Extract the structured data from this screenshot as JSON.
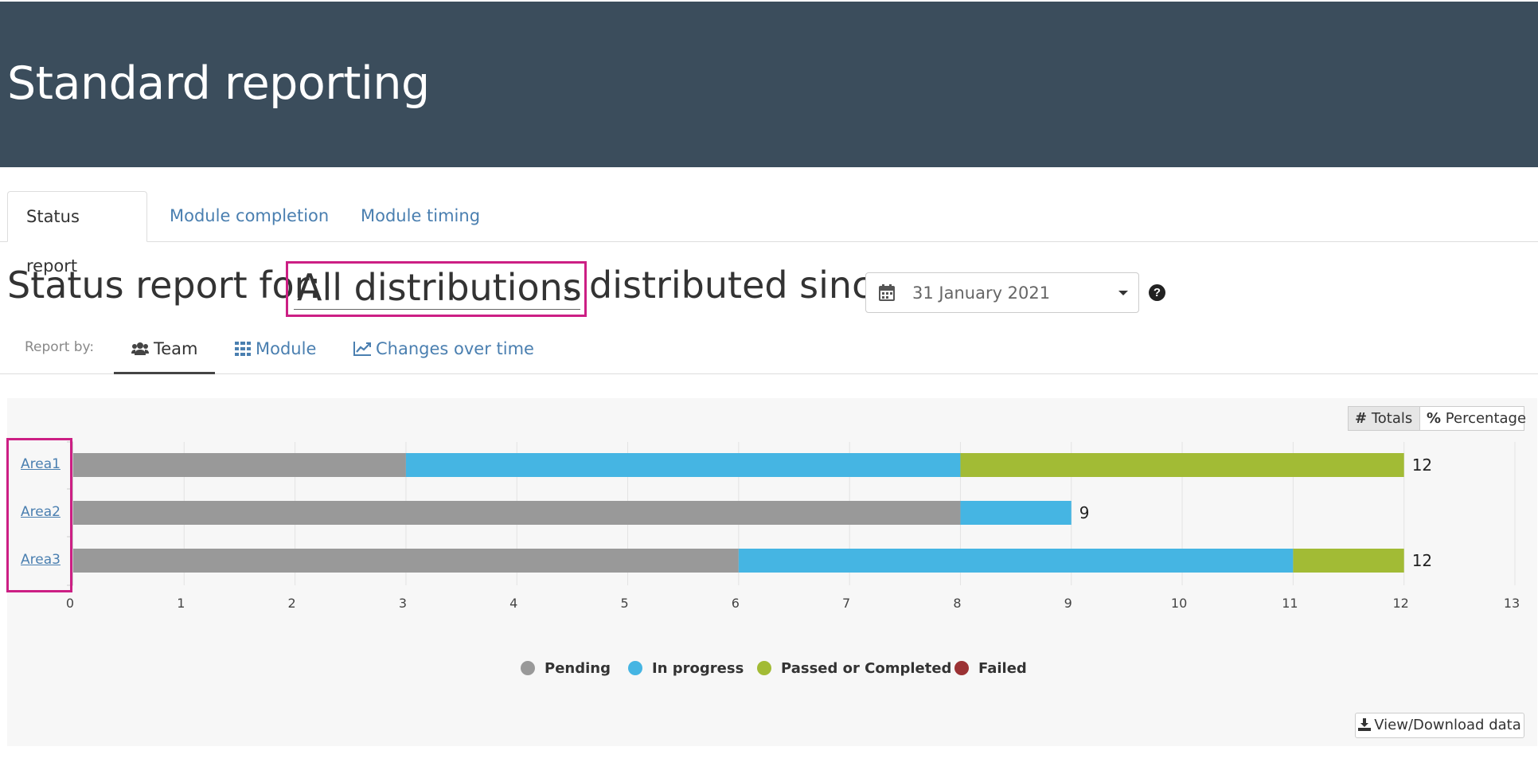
{
  "header": {
    "title": "Standard reporting"
  },
  "tabs": [
    {
      "label": "Status report",
      "active": true
    },
    {
      "label": "Module completion",
      "active": false
    },
    {
      "label": "Module timing",
      "active": false
    }
  ],
  "status_bar": {
    "prefix": "Status report for:",
    "distribution": "All distributions",
    "middle": "distributed since",
    "date": "31 January 2021",
    "help_icon": "question-circle-icon"
  },
  "report_by": {
    "label": "Report by:",
    "options": [
      {
        "label": "Team",
        "icon": "users-icon",
        "active": true
      },
      {
        "label": "Module",
        "icon": "grid-icon",
        "active": false
      },
      {
        "label": "Changes over time",
        "icon": "line-chart-icon",
        "active": false
      }
    ]
  },
  "view_toggle": {
    "totals": "Totals",
    "percentage": "Percentage",
    "selected": "Totals"
  },
  "download": {
    "label": "View/Download data",
    "icon": "download-icon"
  },
  "chart_data": {
    "type": "bar",
    "orientation": "horizontal",
    "stacked": true,
    "categories": [
      "Area1",
      "Area2",
      "Area3"
    ],
    "series": [
      {
        "name": "Pending",
        "color": "#999999",
        "values": [
          3,
          8,
          6
        ]
      },
      {
        "name": "In progress",
        "color": "#45b5e3",
        "values": [
          5,
          1,
          5
        ]
      },
      {
        "name": "Passed or Completed",
        "color": "#a2bb35",
        "values": [
          4,
          0,
          1
        ]
      },
      {
        "name": "Failed",
        "color": "#9b3234",
        "values": [
          0,
          0,
          0
        ]
      }
    ],
    "totals": [
      "12",
      "9",
      "12"
    ],
    "xlim": [
      0,
      13
    ],
    "xticks": [
      "0",
      "1",
      "2",
      "3",
      "4",
      "5",
      "6",
      "7",
      "8",
      "9",
      "10",
      "11",
      "12",
      "13"
    ],
    "grid": true,
    "legend_position": "bottom"
  }
}
